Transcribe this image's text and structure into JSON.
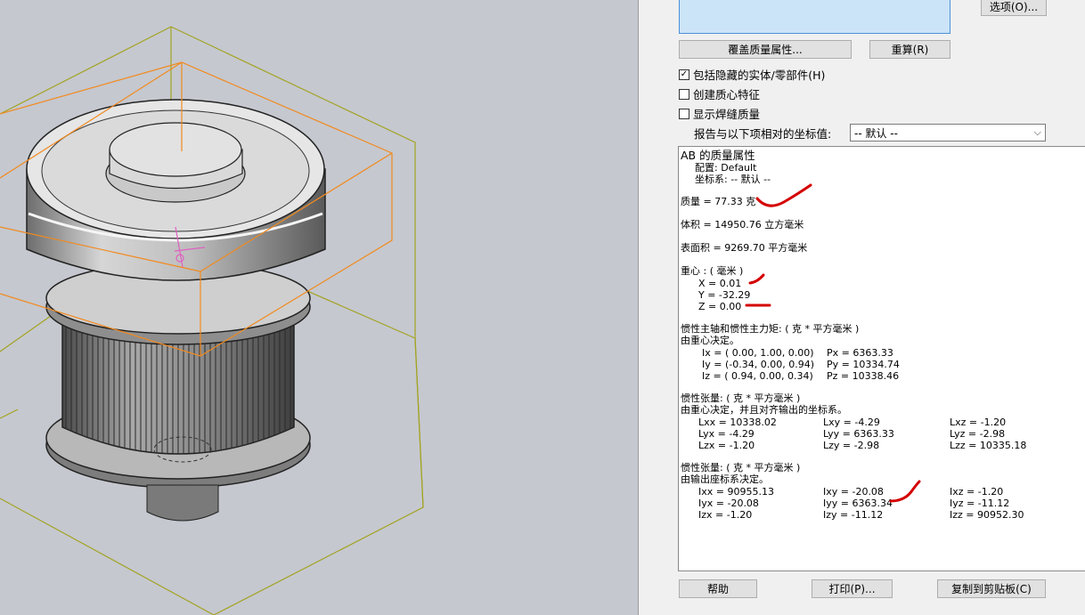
{
  "dialog": {
    "options_button": "选项(O)...",
    "override_button": "覆盖质量属性...",
    "recalc_button": "重算(R)",
    "include_hidden": {
      "label": "包括隐藏的实体/零部件(H)",
      "checked": true
    },
    "create_com": {
      "label": "创建质心特征",
      "checked": false
    },
    "weld_mass": {
      "label": "显示焊缝质量",
      "checked": false
    },
    "coord_label": "报告与以下项相对的坐标值:",
    "coord_value": "-- 默认 --",
    "help_button": "帮助",
    "print_button": "打印(P)...",
    "copy_button": "复制到剪贴板(C)"
  },
  "results": {
    "title": "AB 的质量属性",
    "config": "配置:  Default",
    "coordsys": "坐标系:  -- 默认 --",
    "mass": "质量 = 77.33 克",
    "volume": "体积 = 14950.76 立方毫米",
    "area": "表面积 = 9269.70  平方毫米",
    "com_title": "重心 : ( 毫米 )",
    "com_x": "X = 0.01",
    "com_y": "Y = -32.29",
    "com_z": "Z = 0.00",
    "principal_title": "惯性主轴和惯性主力矩: ( 克 *  平方毫米 )",
    "principal_sub": "由重心决定。",
    "ix": "Ix = ( 0.00,  1.00,  0.00)",
    "iy": "Iy = (-0.34,  0.00,  0.94)",
    "iz": "Iz = ( 0.94,  0.00,  0.34)",
    "px": "Px = 6363.33",
    "py": "Py = 10334.74",
    "pz": "Pz = 10338.46",
    "tensor1_title": "惯性张量: ( 克 *  平方毫米 )",
    "tensor1_sub": "由重心决定，并且对齐输出的坐标系。",
    "tensor1": [
      [
        "Lxx = 10338.02",
        "Lxy = -4.29",
        "Lxz = -1.20"
      ],
      [
        "Lyx = -4.29",
        "Lyy = 6363.33",
        "Lyz = -2.98"
      ],
      [
        "Lzx = -1.20",
        "Lzy = -2.98",
        "Lzz = 10335.18"
      ]
    ],
    "tensor2_title": "惯性张量: ( 克 *  平方毫米 )",
    "tensor2_sub": "由输出座标系决定。",
    "tensor2": [
      [
        "Ixx = 90955.13",
        "Ixy = -20.08",
        "Ixz = -1.20"
      ],
      [
        "Iyx = -20.08",
        "Iyy = 6363.34",
        "Iyz = -11.12"
      ],
      [
        "Izx = -1.20",
        "Izy = -11.12",
        "Izz = 90952.30"
      ]
    ]
  },
  "colors": {
    "annotation": "#d40000",
    "bbox_orange": "#f28a1e",
    "bbox_olive": "#a0a020"
  },
  "viewport": {
    "model": "timing-pulley-3d-model"
  }
}
